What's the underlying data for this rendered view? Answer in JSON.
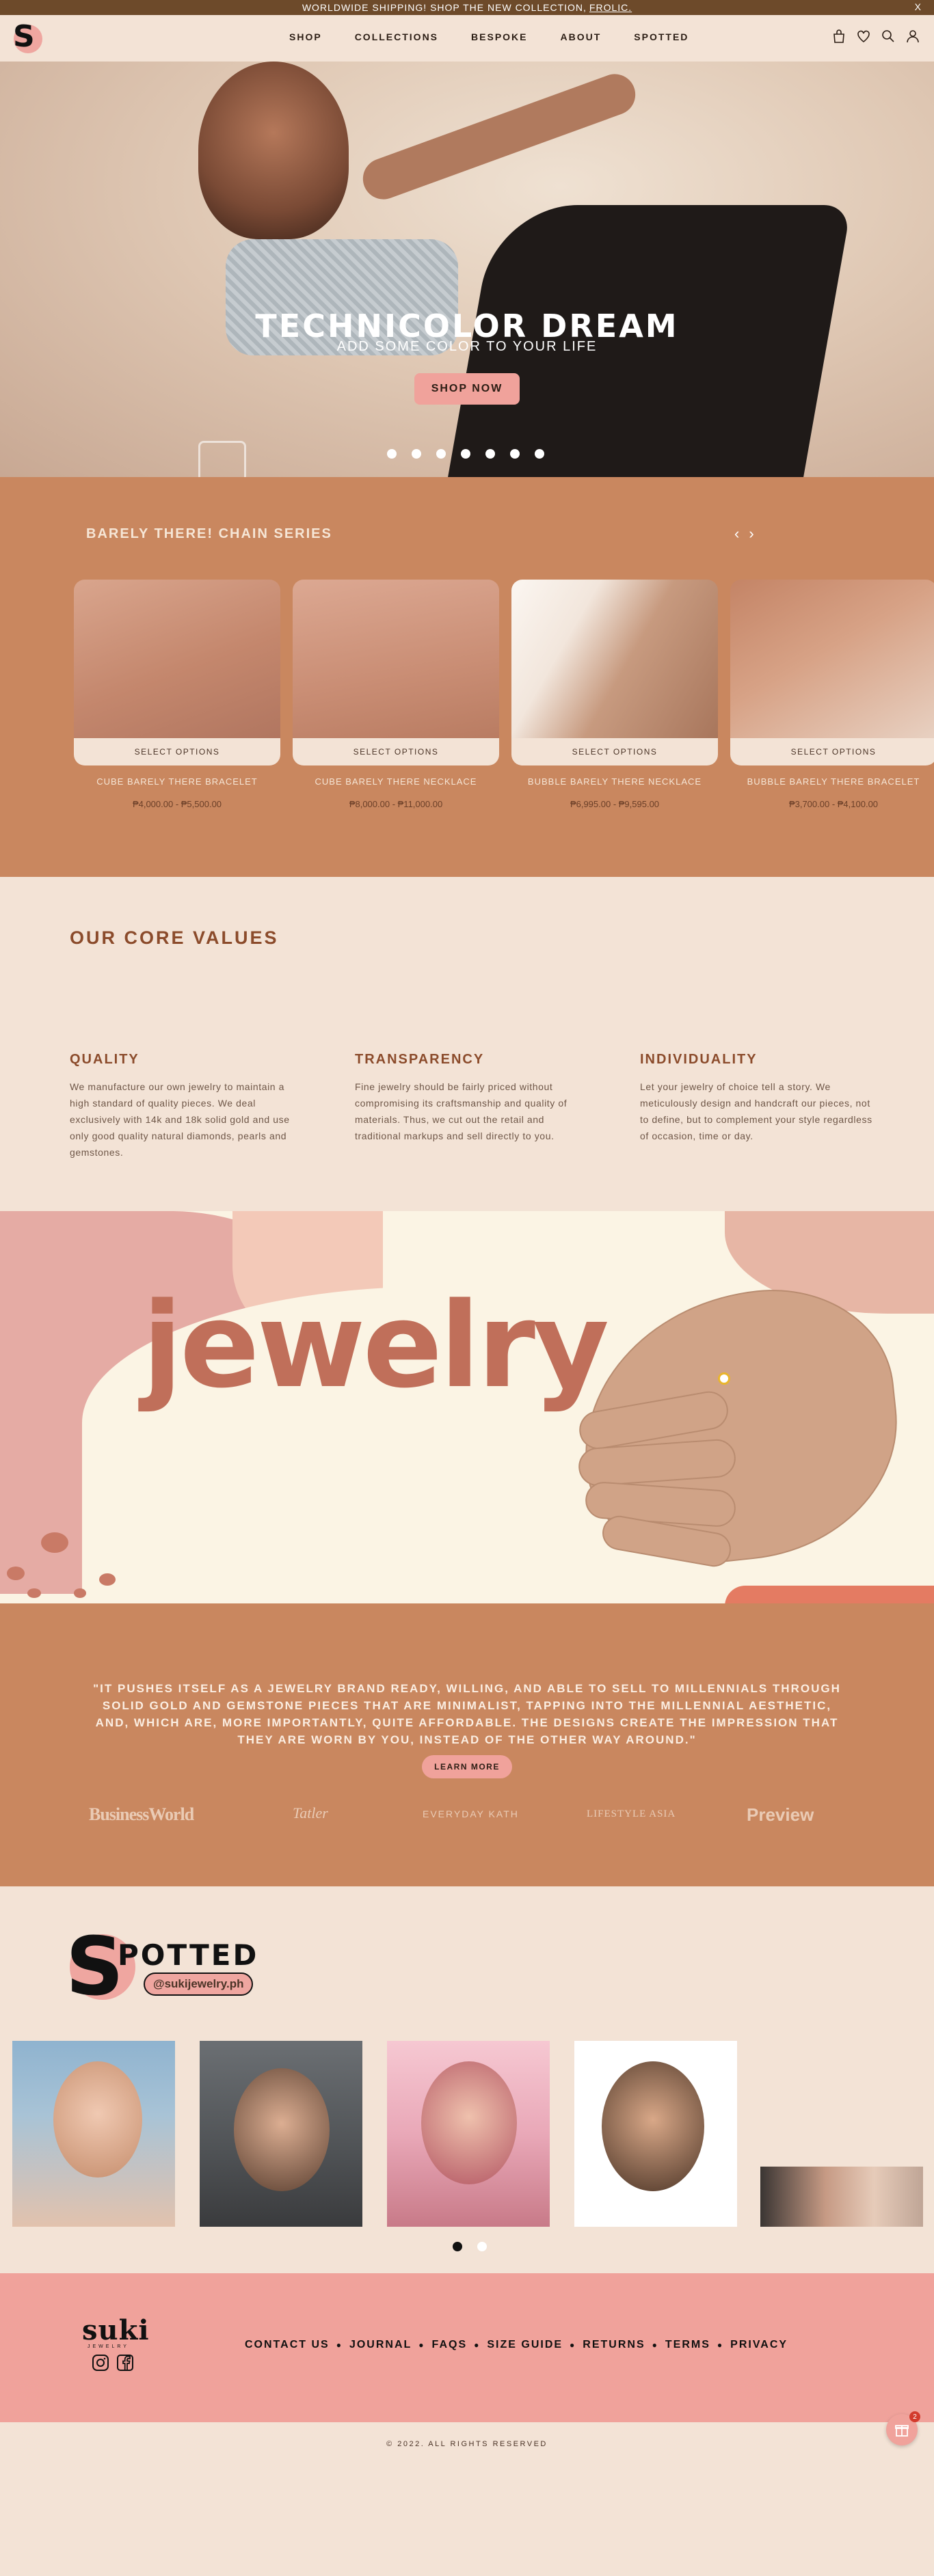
{
  "announcement": {
    "text": "WORLDWIDE SHIPPING! SHOP THE NEW COLLECTION,",
    "link": "FROLIC.",
    "close": "x"
  },
  "header": {
    "logo_letter": "S",
    "nav": [
      "SHOP",
      "COLLECTIONS",
      "BESPOKE",
      "ABOUT",
      "SPOTTED"
    ],
    "icons": [
      "bag-icon",
      "heart-icon",
      "search-icon",
      "user-icon"
    ]
  },
  "hero": {
    "title": "TECHNICOLOR DREAM",
    "subtitle": "ADD SOME COLOR TO YOUR LIFE",
    "button": "SHOP NOW",
    "slide_count": 7
  },
  "series": {
    "title": "BARELY THERE! CHAIN SERIES",
    "prev": "‹",
    "next": "›",
    "cards": [
      {
        "name": "CUBE BARELY THERE BRACELET",
        "price": "₱4,000.00 - ₱5,500.00",
        "button": "SELECT OPTIONS"
      },
      {
        "name": "CUBE BARELY THERE NECKLACE",
        "price": "₱8,000.00 - ₱11,000.00",
        "button": "SELECT OPTIONS"
      },
      {
        "name": "BUBBLE BARELY THERE NECKLACE",
        "price": "₱6,995.00 - ₱9,595.00",
        "button": "SELECT OPTIONS"
      },
      {
        "name": "BUBBLE BARELY THERE BRACELET",
        "price": "₱3,700.00 - ₱4,100.00",
        "button": "SELECT OPTIONS"
      }
    ]
  },
  "values": {
    "title": "OUR CORE VALUES",
    "items": [
      {
        "heading": "QUALITY",
        "text": "We manufacture our own jewelry to maintain a high standard of quality pieces. We deal exclusively with 14k and 18k solid gold and use only good quality natural diamonds, pearls and gemstones."
      },
      {
        "heading": "TRANSPARENCY",
        "text": "Fine jewelry should be fairly priced without compromising its craftsmanship and quality of materials. Thus, we cut out the retail and traditional markups and sell directly to you."
      },
      {
        "heading": "INDIVIDUALITY",
        "text": "Let your jewelry of choice tell a story. We meticulously design and handcraft our pieces, not to define, but to complement your style regardless of occasion, time or day."
      }
    ]
  },
  "banner": {
    "word": "jewelry"
  },
  "quote": {
    "text": "\"IT PUSHES ITSELF AS A JEWELRY BRAND READY, WILLING, AND ABLE TO SELL TO MILLENNIALS THROUGH SOLID GOLD AND GEMSTONE PIECES THAT ARE MINIMALIST, TAPPING INTO THE MILLENNIAL AESTHETIC, AND, WHICH ARE, MORE IMPORTANTLY, QUITE AFFORDABLE. THE DESIGNS CREATE THE IMPRESSION THAT THEY ARE WORN BY YOU, INSTEAD OF THE OTHER WAY AROUND.\"",
    "button": "LEARN MORE",
    "press": [
      "BusinessWorld",
      "Tatler",
      "EVERYDAY KATH",
      "LIFESTYLE ASIA",
      "Preview"
    ]
  },
  "spotted": {
    "letter": "S",
    "word": "POTTED",
    "handle": "@sukijewelry.ph",
    "page_count": 2
  },
  "footer": {
    "logo": "suki",
    "logo_sub": "JEWELRY",
    "links": [
      "CONTACT US",
      "JOURNAL",
      "FAQS",
      "SIZE GUIDE",
      "RETURNS",
      "TERMS",
      "PRIVACY"
    ],
    "separator": "●",
    "copyright": "© 2022. ALL RIGHTS RESERVED",
    "gift_badge": "2"
  },
  "colors": {
    "accent_pink": "#f0a29b",
    "terracotta": "#c9875f",
    "cream": "#f3e3d6",
    "brown_text": "#8b4b2b"
  }
}
